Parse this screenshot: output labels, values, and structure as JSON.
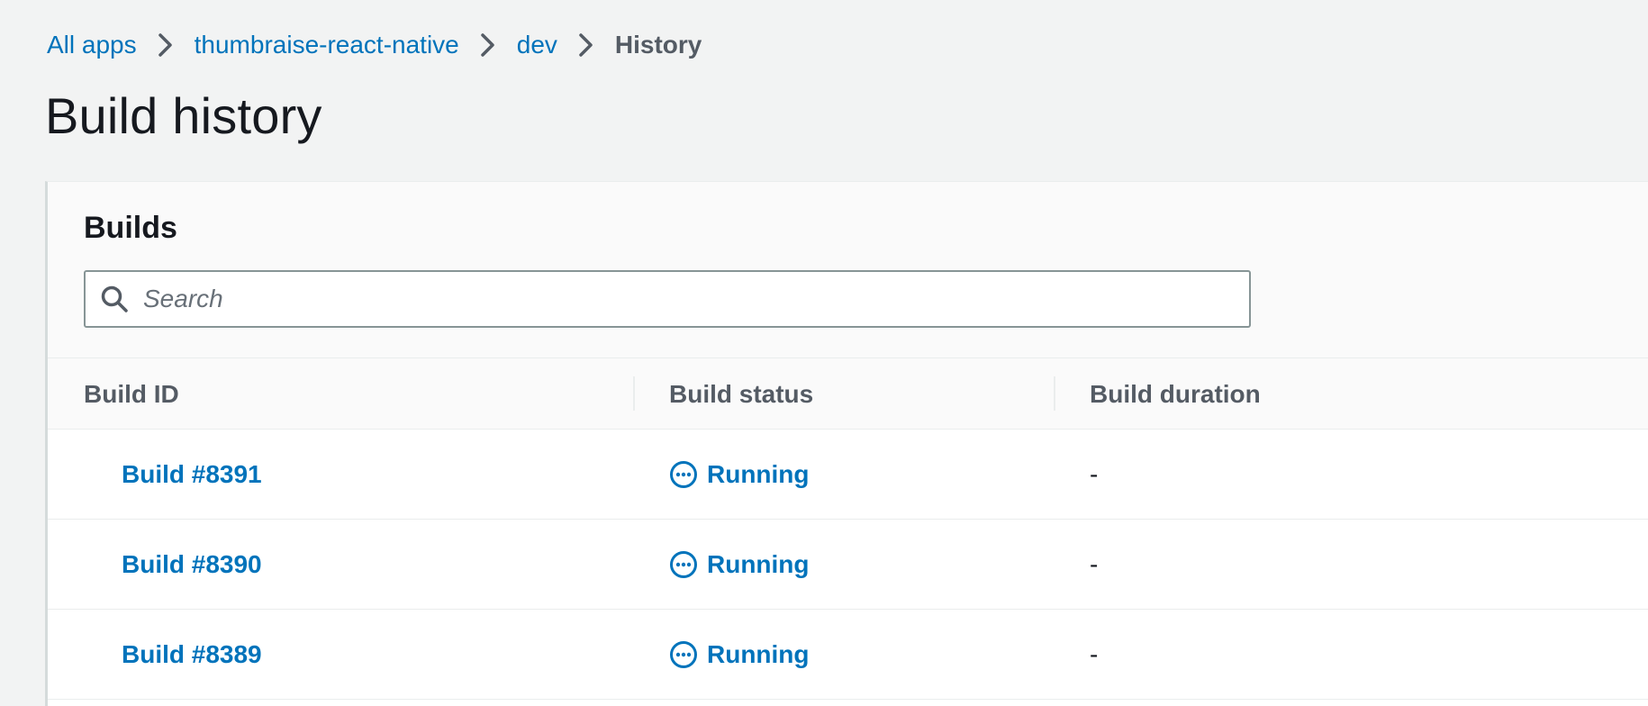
{
  "breadcrumb": {
    "items": [
      {
        "label": "All apps"
      },
      {
        "label": "thumbraise-react-native"
      },
      {
        "label": "dev"
      }
    ],
    "current": "History"
  },
  "page_title": "Build history",
  "builds_panel": {
    "title": "Builds",
    "search": {
      "placeholder": "Search",
      "value": ""
    },
    "columns": [
      "Build ID",
      "Build status",
      "Build duration"
    ],
    "rows": [
      {
        "id": "Build #8391",
        "status": "Running",
        "duration": "-"
      },
      {
        "id": "Build #8390",
        "status": "Running",
        "duration": "-"
      },
      {
        "id": "Build #8389",
        "status": "Running",
        "duration": "-"
      }
    ]
  },
  "icons": {
    "breadcrumb_separator": "chevron-right-icon",
    "search": "search-icon",
    "status_running": "in-progress-icon"
  },
  "colors": {
    "link": "#0073bb",
    "text": "#16191f",
    "muted": "#545b64",
    "background": "#f2f3f3"
  }
}
